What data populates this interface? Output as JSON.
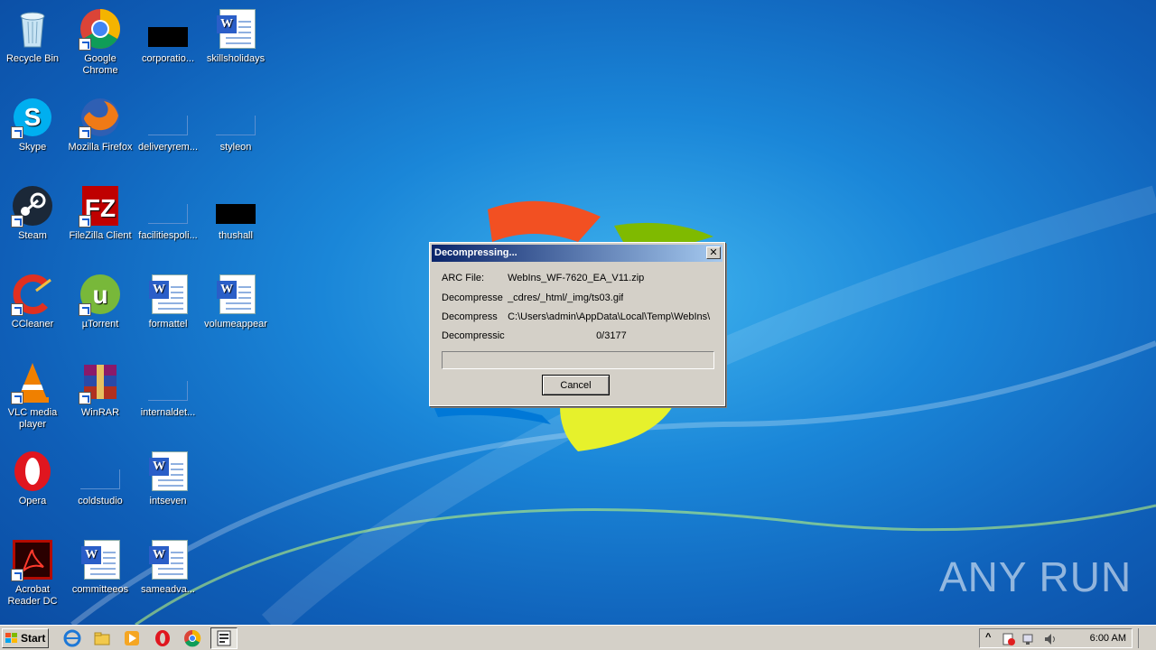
{
  "desktop": {
    "icons": [
      {
        "label": "Recycle Bin"
      },
      {
        "label": "Google Chrome"
      },
      {
        "label": "corporatio..."
      },
      {
        "label": "skillsholidays"
      },
      {
        "label": "Skype"
      },
      {
        "label": "Mozilla Firefox"
      },
      {
        "label": "deliveryrem..."
      },
      {
        "label": "styleon"
      },
      {
        "label": "Steam"
      },
      {
        "label": "FileZilla Client"
      },
      {
        "label": "facilitiespoli..."
      },
      {
        "label": "thushall"
      },
      {
        "label": "CCleaner"
      },
      {
        "label": "µTorrent"
      },
      {
        "label": "formattel"
      },
      {
        "label": "volumeappear"
      },
      {
        "label": "VLC media player"
      },
      {
        "label": "WinRAR"
      },
      {
        "label": "internaldet..."
      },
      {
        "label": "Opera"
      },
      {
        "label": "coldstudio"
      },
      {
        "label": "intseven"
      },
      {
        "label": "Acrobat Reader DC"
      },
      {
        "label": "committeeos"
      },
      {
        "label": "sameadva..."
      }
    ]
  },
  "dialog": {
    "title": "Decompressing...",
    "close_glyph": "✕",
    "arc_label": "ARC File:",
    "arc_value": "WebIns_WF-7620_EA_V11.zip",
    "decompress1_label": "Decompresse",
    "decompress1_value": "_cdres/_html/_img/ts03.gif",
    "decompress2_label": "Decompress",
    "decompress2_value": "C:\\Users\\admin\\AppData\\Local\\Temp\\WebIns\\",
    "count_label": "Decompressic",
    "count_value": "0/3177",
    "progress": 0,
    "cancel_label": "Cancel"
  },
  "taskbar": {
    "start_label": "Start",
    "clock": "6:00 AM",
    "tray_arrow": "^"
  },
  "watermark": "ANY RUN",
  "colors": {
    "titlebar_start": "#0a246a",
    "titlebar_end": "#a6caf0",
    "dialog_bg": "#d4d0c8"
  }
}
